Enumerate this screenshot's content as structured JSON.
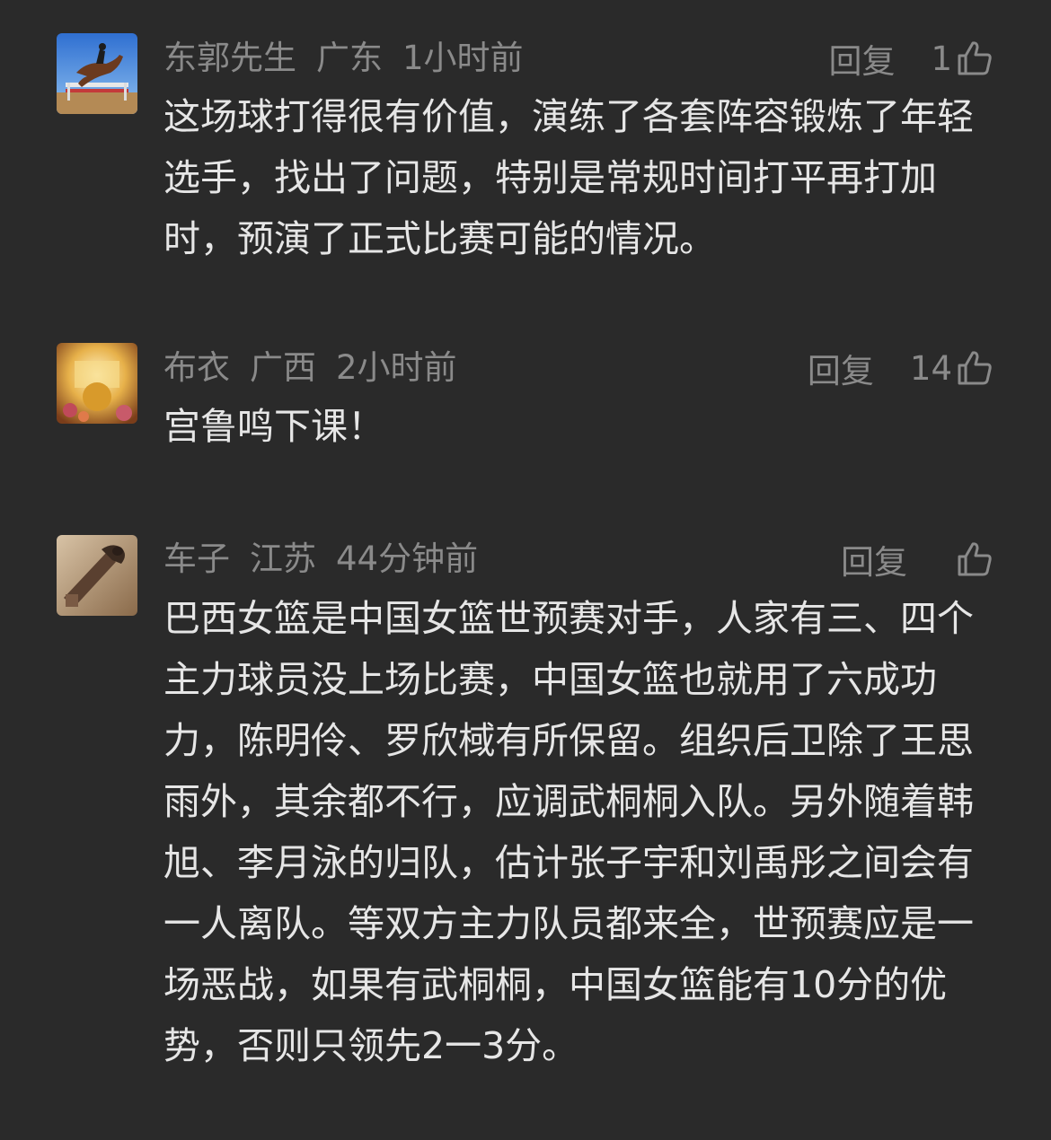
{
  "comments": [
    {
      "username": "东郭先生",
      "location": "广东",
      "time": "1小时前",
      "reply_label": "回复",
      "like_count": "1",
      "avatar_icon": "horse-jumping-avatar-icon",
      "text": "这场球打得很有价值，演练了各套阵容锻炼了年轻选手，找出了问题，特别是常规时间打平再打加时，预演了正式比赛可能的情况。"
    },
    {
      "username": "布衣",
      "location": "广西",
      "time": "2小时前",
      "reply_label": "回复",
      "like_count": "14",
      "avatar_icon": "golden-landscape-avatar-icon",
      "text": "宫鲁鸣下课！"
    },
    {
      "username": "车子",
      "location": "江苏",
      "time": "44分钟前",
      "reply_label": "回复",
      "like_count": "",
      "avatar_icon": "statue-avatar-icon",
      "text": "巴西女篮是中国女篮世预赛对手，人家有三、四个主力球员没上场比赛，中国女篮也就用了六成功力，陈明伶、罗欣棫有所保留。组织后卫除了王思雨外，其余都不行，应调武桐桐入队。另外随着韩旭、李月泳的归队，估计张子宇和刘禹彤之间会有一人离队。等双方主力队员都来全，世预赛应是一场恶战，如果有武桐桐，中国女篮能有10分的优势，否则只领先2一3分。"
    }
  ],
  "colors": {
    "background": "#2a2a2a",
    "meta_text": "#8a8a8a",
    "body_text": "#e6e6e6"
  }
}
